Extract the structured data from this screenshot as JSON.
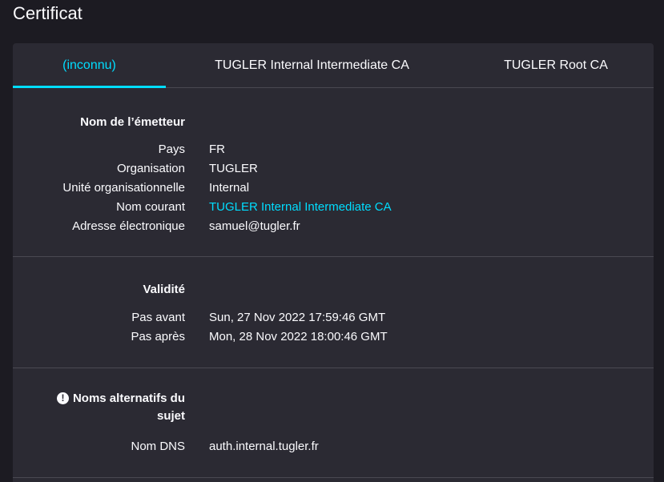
{
  "page": {
    "title": "Certificat"
  },
  "tabs": [
    {
      "label": "(inconnu)",
      "selected": true
    },
    {
      "label": "TUGLER Internal Intermediate CA",
      "selected": false
    },
    {
      "label": "TUGLER Root CA",
      "selected": false
    }
  ],
  "issuer": {
    "heading": "Nom de l’émetteur",
    "rows": [
      {
        "label": "Pays",
        "value": "FR"
      },
      {
        "label": "Organisation",
        "value": "TUGLER"
      },
      {
        "label": "Unité organisationnelle",
        "value": "Internal"
      },
      {
        "label": "Nom courant",
        "value": "TUGLER Internal Intermediate CA"
      },
      {
        "label": "Adresse électronique",
        "value": "samuel@tugler.fr"
      }
    ]
  },
  "validity": {
    "heading": "Validité",
    "rows": [
      {
        "label": "Pas avant",
        "value": "Sun, 27 Nov 2022 17:59:46 GMT"
      },
      {
        "label": "Pas après",
        "value": "Mon, 28 Nov 2022 18:00:46 GMT"
      }
    ]
  },
  "san": {
    "heading_line1": "Noms alternatifs du",
    "heading_line2": "sujet",
    "warning_icon": "exclamation-circle-icon",
    "rows": [
      {
        "label": "Nom DNS",
        "value": "auth.internal.tugler.fr"
      }
    ]
  },
  "colors": {
    "accent": "#00ddff",
    "background": "#1c1b22",
    "card": "#2b2a33",
    "text": "#fbfbfe",
    "divider": "#4a4952"
  }
}
